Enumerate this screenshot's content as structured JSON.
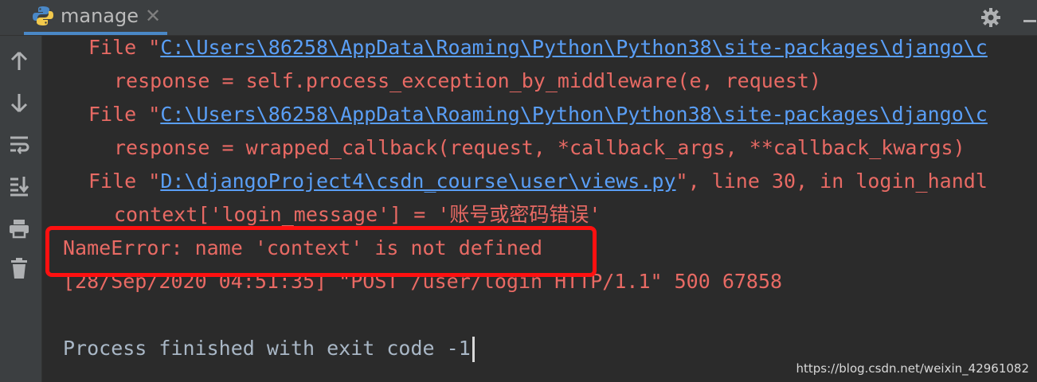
{
  "tab": {
    "label": "manage",
    "close": "✕",
    "icon": "python-icon"
  },
  "toolbar": {
    "settings_icon": "gear-icon",
    "minimize_icon": "minimize-icon"
  },
  "sidebar": {
    "items": [
      {
        "icon": "arrow-up-icon"
      },
      {
        "icon": "arrow-down-icon"
      },
      {
        "icon": "soft-wrap-icon"
      },
      {
        "icon": "scroll-to-end-icon"
      },
      {
        "icon": "print-icon"
      },
      {
        "icon": "trash-icon"
      }
    ]
  },
  "console": {
    "l1": {
      "prefix": "File \"",
      "link": "C:\\Users\\86258\\AppData\\Roaming\\Python\\Python38\\site-packages\\django\\c"
    },
    "l2": "response = self.process_exception_by_middleware(e, request)",
    "l3": {
      "prefix": "File \"",
      "link": "C:\\Users\\86258\\AppData\\Roaming\\Python\\Python38\\site-packages\\django\\c"
    },
    "l4": "response = wrapped_callback(request, *callback_args, **callback_kwargs)",
    "l5": {
      "prefix": "File \"",
      "link": "D:\\djangoProject4\\csdn_course\\user\\views.py",
      "suffix": "\", line 30, in login_handl"
    },
    "l6": "context['login_message'] = '账号或密码错误'",
    "l7": "NameError: name 'context' is not defined",
    "l8": "[28/Sep/2020 04:51:35] \"POST /user/login HTTP/1.1\" 500 67858",
    "l9": "Process finished with exit code -1"
  },
  "watermark": "https://blog.csdn.net/weixin_42961082",
  "colors": {
    "error": "#e86a64",
    "link": "#5a9ff7",
    "background": "#2b2b2b",
    "highlight": "#ff1010"
  }
}
